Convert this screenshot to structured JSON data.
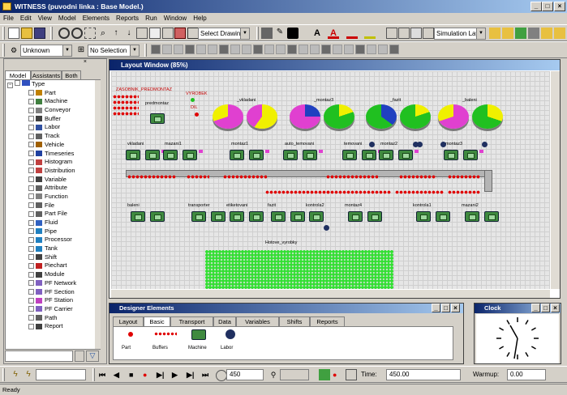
{
  "window": {
    "title": "WITNESS (puvodni linka : Base Model.)"
  },
  "menu": [
    "File",
    "Edit",
    "View",
    "Model",
    "Elements",
    "Reports",
    "Run",
    "Window",
    "Help"
  ],
  "toolbar": {
    "drawing_select": "Select Drawing",
    "sim_layer": "Simulation Laye",
    "unknown": "Unknown",
    "no_selection": "No Selection"
  },
  "sidebar": {
    "tabs": [
      "Model",
      "Assistants",
      "Both"
    ],
    "root": "Type",
    "items": [
      "Part",
      "Machine",
      "Conveyor",
      "Buffer",
      "Labor",
      "Track",
      "Vehicle",
      "Timeseries",
      "Histogram",
      "Distribution",
      "Variable",
      "Attribute",
      "Function",
      "File",
      "Part File",
      "Fluid",
      "Pipe",
      "Processor",
      "Tank",
      "Shift",
      "Piechart",
      "Module",
      "PF Network",
      "PF Section",
      "PF Station",
      "PF Carrier",
      "Path",
      "Report"
    ]
  },
  "layout": {
    "title": "Layout Window (85%)",
    "labels": {
      "zasobnik": "ZASOBNIK_PREDMONTAZ",
      "vyrobek": "VYROBEK",
      "dil": "DIL",
      "predmontaz": "predmontaz",
      "hotove": "Hotove_vyrobky"
    },
    "pies": [
      "_vkladani",
      "_montaz3",
      "_fazit",
      "_baleni"
    ],
    "row1": [
      "vkladani",
      "mazani1",
      "montaz1",
      "auto_temovani",
      "temovani",
      "montaz2",
      "montaz3"
    ],
    "row2": [
      "baleni",
      "transporter",
      "etiketovani",
      "fazit",
      "kontrola2",
      "montaz4",
      "kontrola1",
      "mazani2"
    ]
  },
  "designer": {
    "title": "Designer Elements",
    "tabs": [
      "Layout",
      "Basic",
      "Transport",
      "Data",
      "Variables",
      "Shifts",
      "Reports"
    ],
    "elements": [
      "Part",
      "Buffers",
      "Machine",
      "Labor"
    ]
  },
  "clock": {
    "title": "Clock"
  },
  "bottom": {
    "step": "450",
    "time_label": "Time:",
    "time_value": "450.00",
    "warmup_label": "Warmup:",
    "warmup_value": "0.00"
  },
  "status": "Ready",
  "colors": {
    "pie_magenta": "#e040d0",
    "pie_yellow": "#f0f000",
    "pie_blue": "#2040c0",
    "pie_green": "#20c020",
    "machine": "#3f8a3f",
    "part": "#e00000"
  }
}
